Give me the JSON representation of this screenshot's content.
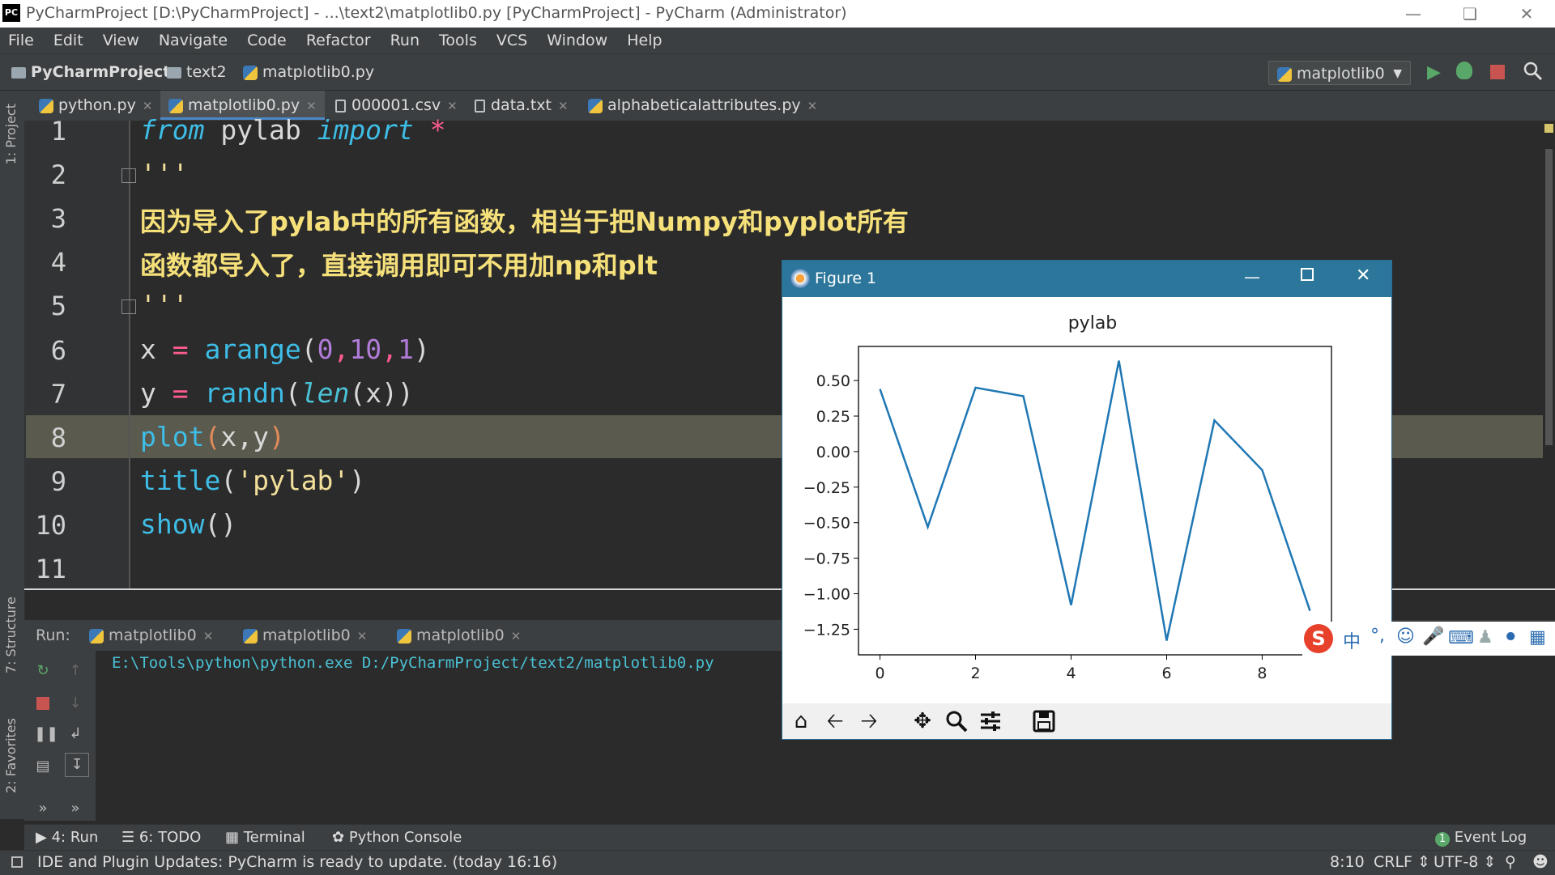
{
  "window": {
    "title": "PyCharmProject [D:\\PyCharmProject] - ...\\text2\\matplotlib0.py [PyCharmProject] - PyCharm (Administrator)",
    "app_badge": "PC"
  },
  "menu": [
    "File",
    "Edit",
    "View",
    "Navigate",
    "Code",
    "Refactor",
    "Run",
    "Tools",
    "VCS",
    "Window",
    "Help"
  ],
  "breadcrumb": {
    "project": "PyCharmProject",
    "folder": "text2",
    "file": "matplotlib0.py"
  },
  "run_config": "matplotlib0",
  "tabs": [
    {
      "label": "python.py"
    },
    {
      "label": "matplotlib0.py",
      "active": true
    },
    {
      "label": "000001.csv"
    },
    {
      "label": "data.txt"
    },
    {
      "label": "alphabeticalattributes.py"
    }
  ],
  "left_strip": {
    "project": "1: Project",
    "structure": "7: Structure",
    "favorites": "2: Favorites"
  },
  "editor": {
    "line_numbers": [
      "1",
      "2",
      "3",
      "4",
      "5",
      "6",
      "7",
      "8",
      "9",
      "10",
      "11"
    ],
    "lines": {
      "l1a": "from",
      "l1b": " pylab ",
      "l1c": "import",
      "l1d": " *",
      "l2": "'''",
      "l3": "因为导入了pylab中的所有函数，相当于把Numpy和pyplot所有",
      "l4": "函数都导入了，直接调用即可不用加np和plt",
      "l5": "'''",
      "l6a": "x ",
      "l6b": "=",
      "l6c": " arange",
      "l6d": "(",
      "l6e": "0",
      "l6f": ",",
      "l6g": "10",
      "l6h": ",",
      "l6i": "1",
      "l6j": ")",
      "l7a": "y ",
      "l7b": "=",
      "l7c": " randn",
      "l7d": "(",
      "l7e": "len",
      "l7f": "(x))",
      "l8a": "plot",
      "l8b": "(",
      "l8c": "x,y",
      "l8d": ")",
      "l9a": "title",
      "l9b": "(",
      "l9c": "'pylab'",
      "l9d": ")",
      "l10a": "show",
      "l10b": "()"
    }
  },
  "run_panel": {
    "label": "Run:",
    "tabs": [
      "matplotlib0",
      "matplotlib0",
      "matplotlib0"
    ],
    "output": "E:\\Tools\\python\\python.exe D:/PyCharmProject/text2/matplotlib0.py"
  },
  "bottom_tabs": {
    "run": "4: Run",
    "todo": "6: TODO",
    "terminal": "Terminal",
    "console": "Python Console",
    "eventlog": "Event Log",
    "eventcount": "1"
  },
  "status": {
    "message": "IDE and Plugin Updates: PyCharm is ready to update. (today 16:16)",
    "position": "8:10",
    "line_sep": "CRLF",
    "encoding": "UTF-8"
  },
  "figure": {
    "title": "Figure 1"
  },
  "ime": {
    "label": "中"
  },
  "chart_data": {
    "type": "line",
    "title": "pylab",
    "x": [
      0,
      1,
      2,
      3,
      4,
      5,
      6,
      7,
      8,
      9
    ],
    "y": [
      0.44,
      -0.53,
      0.45,
      0.39,
      -1.08,
      0.64,
      -1.33,
      0.22,
      -0.13,
      -1.12
    ],
    "xticks": [
      "0",
      "2",
      "4",
      "6",
      "8"
    ],
    "yticks": [
      "0.50",
      "0.25",
      "0.00",
      "−0.25",
      "−0.50",
      "−0.75",
      "−1.00",
      "−1.25"
    ],
    "xlim": [
      -0.45,
      9.45
    ],
    "ylim": [
      -1.43,
      0.74
    ],
    "line_color": "#1f77b4",
    "grid": false
  }
}
